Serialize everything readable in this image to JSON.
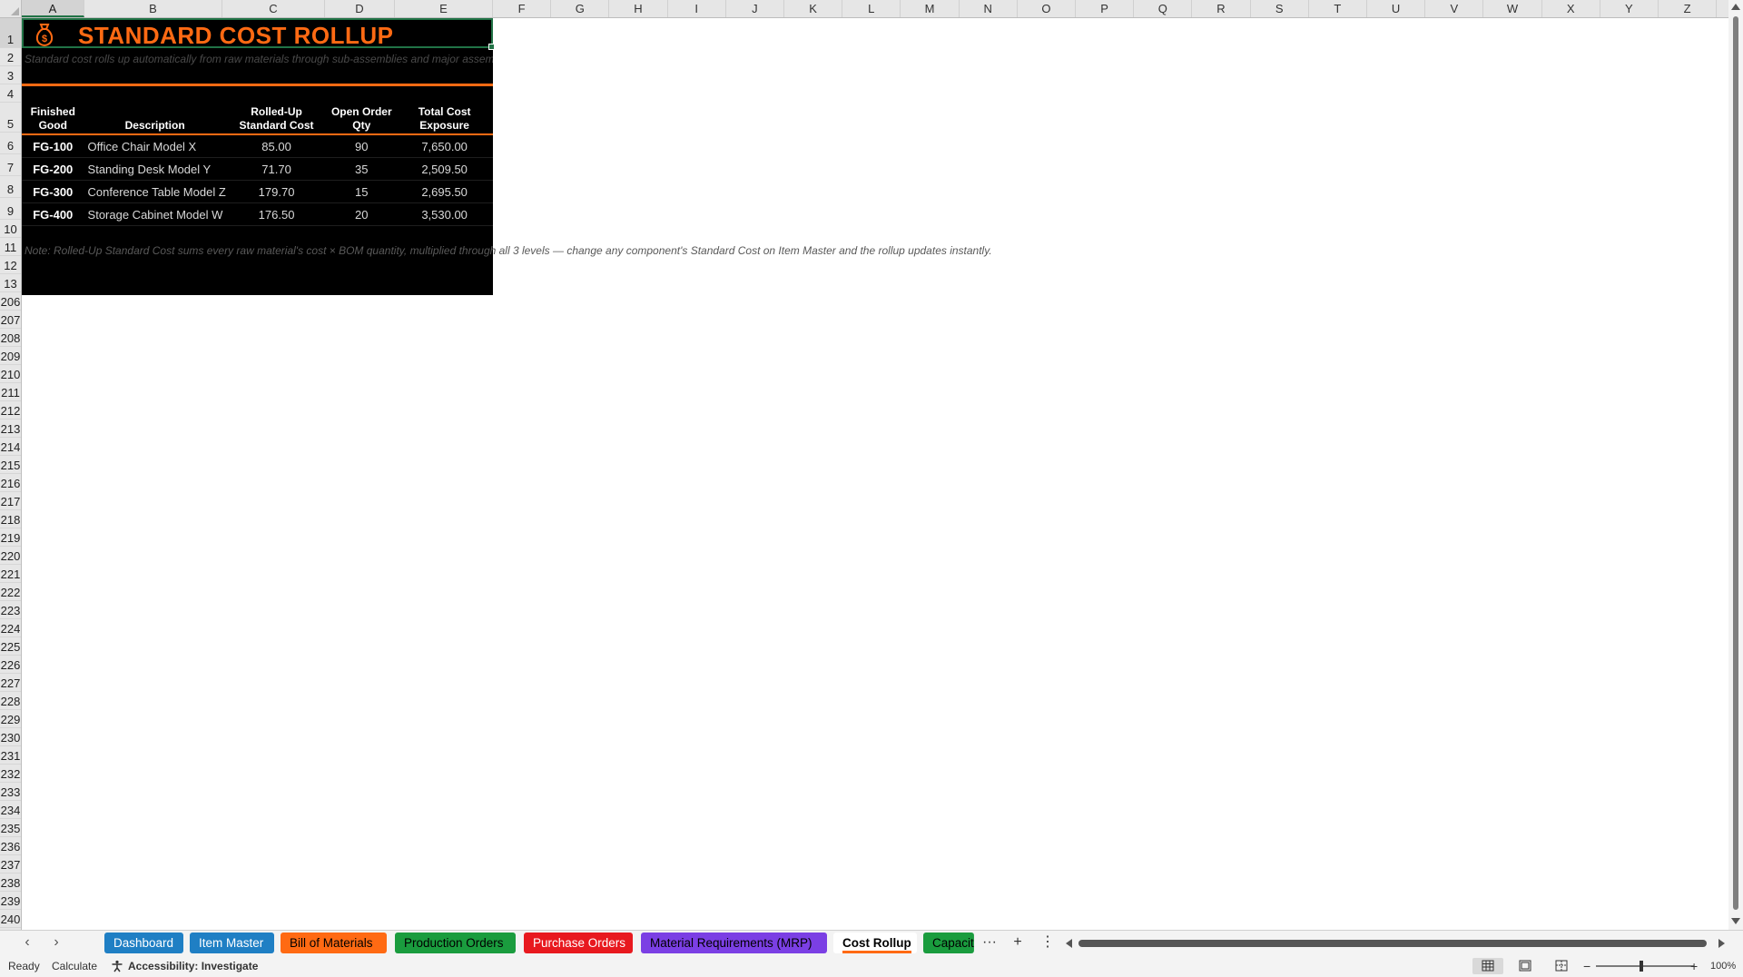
{
  "columns": [
    "A",
    "B",
    "C",
    "D",
    "E",
    "F",
    "G",
    "H",
    "I",
    "J",
    "K",
    "L",
    "M",
    "N",
    "O",
    "P",
    "Q",
    "R",
    "S",
    "T",
    "U",
    "V",
    "W",
    "X",
    "Y",
    "Z"
  ],
  "rows": [
    "1",
    "2",
    "3",
    "4",
    "5",
    "6",
    "7",
    "8",
    "9",
    "10",
    "11",
    "12",
    "13",
    "206",
    "207",
    "208",
    "209",
    "210",
    "211",
    "212",
    "213",
    "214",
    "215",
    "216",
    "217",
    "218",
    "219",
    "220",
    "221",
    "222",
    "223",
    "224",
    "225",
    "226",
    "227",
    "228",
    "229",
    "230",
    "231",
    "232",
    "233",
    "234",
    "235",
    "236",
    "237",
    "238",
    "239",
    "240"
  ],
  "sheet": {
    "title": "STANDARD COST ROLLUP",
    "title_icon": "money-bag-icon",
    "subtitle": "Standard cost rolls up automatically from raw materials through sub-assemblies and major assemblies",
    "table": {
      "headers": [
        [
          "Finished",
          "Good"
        ],
        [
          "Description"
        ],
        [
          "Rolled-Up",
          "Standard Cost"
        ],
        [
          "Open Order",
          "Qty"
        ],
        [
          "Total Cost",
          "Exposure"
        ]
      ],
      "rows": [
        {
          "code": "FG-100",
          "description": "Office Chair Model X",
          "cost": "85.00",
          "qty": "90",
          "exposure": "7,650.00"
        },
        {
          "code": "FG-200",
          "description": "Standing Desk Model Y",
          "cost": "71.70",
          "qty": "35",
          "exposure": "2,509.50"
        },
        {
          "code": "FG-300",
          "description": "Conference Table Model Z",
          "cost": "179.70",
          "qty": "15",
          "exposure": "2,695.50"
        },
        {
          "code": "FG-400",
          "description": "Storage Cabinet Model W",
          "cost": "176.50",
          "qty": "20",
          "exposure": "3,530.00"
        }
      ]
    },
    "note": "Note: Rolled-Up Standard Cost sums every raw material's cost × BOM quantity, multiplied through all 3 levels — change any component's Standard Cost on Item Master and the rollup updates instantly."
  },
  "tabs": [
    {
      "label": "Dashboard",
      "bg": "#1f7fc4",
      "fg": "#ffffff"
    },
    {
      "label": "Item Master",
      "bg": "#1f7fc4",
      "fg": "#ffffff"
    },
    {
      "label": "Bill of Materials",
      "bg": "#ff6a13",
      "fg": "#000000"
    },
    {
      "label": "Production Orders",
      "bg": "#1a9c3e",
      "fg": "#000000"
    },
    {
      "label": "Purchase Orders",
      "bg": "#e8191f",
      "fg": "#ffffff"
    },
    {
      "label": "Material Requirements (MRP)",
      "bg": "#7b3fe4",
      "fg": "#000000"
    },
    {
      "label": "Cost Rollup",
      "bg": "#ffffff",
      "fg": "#000000"
    },
    {
      "label": "Capacit",
      "bg": "#1a9c3e",
      "fg": "#000000"
    }
  ],
  "active_tab": "Cost Rollup",
  "tab_controls": {
    "more": "···",
    "add": "+",
    "options": "⋮"
  },
  "status": {
    "ready": "Ready",
    "calculate": "Calculate",
    "accessibility": "Accessibility: Investigate",
    "zoom": "100%",
    "zoom_out": "−",
    "zoom_in": "+"
  },
  "colors": {
    "accent": "#ff6a13",
    "selection": "#217346",
    "sheet_bg": "#000000"
  }
}
